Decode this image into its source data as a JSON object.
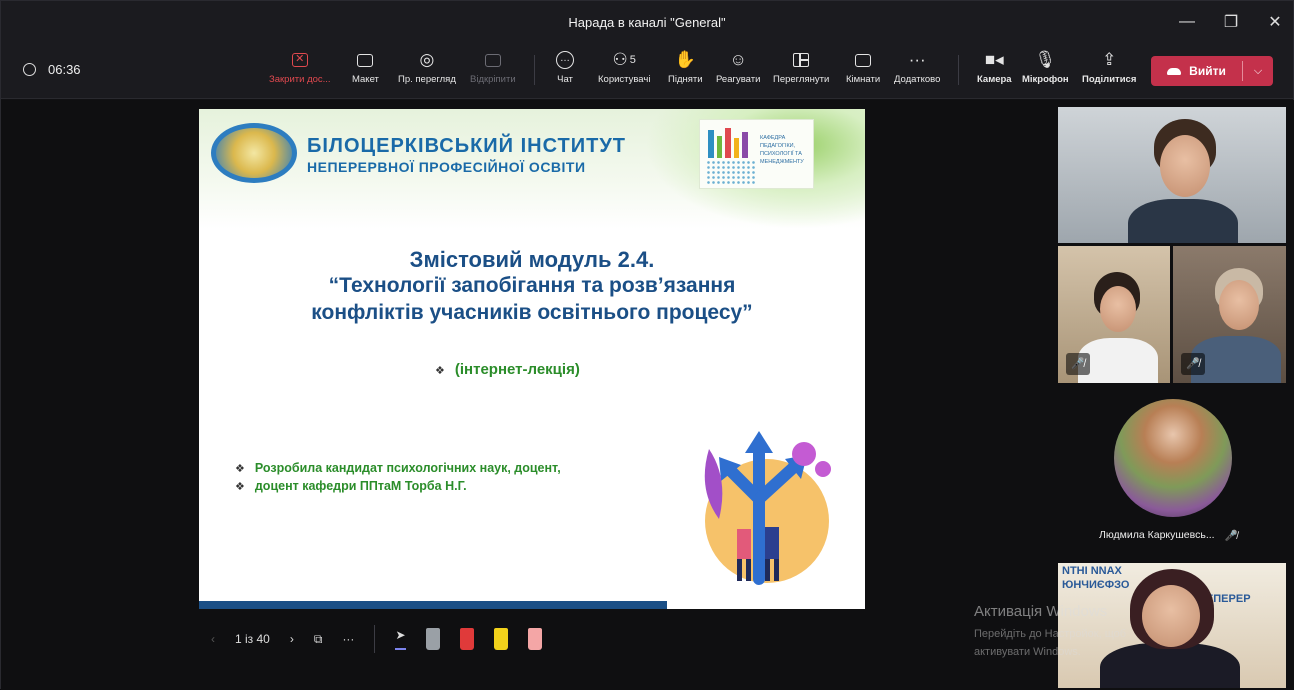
{
  "window": {
    "title": "Нарада в каналі \"General\""
  },
  "window_controls": {
    "minimize": "—",
    "maximize": "❐",
    "close": "✕"
  },
  "toolbar": {
    "timer": "06:36",
    "stop_sharing": "Закрити дос...",
    "layout": "Макет",
    "presenter_view": "Пр. перегляд",
    "pop_out": "Відкріпити",
    "chat": "Чат",
    "people": "Користувачі",
    "people_count": "5",
    "raise_hand": "Підняти",
    "react": "Реагувати",
    "view": "Переглянути",
    "rooms": "Кімнати",
    "more": "Додатково",
    "camera": "Камера",
    "mic": "Мікрофон",
    "share": "Поділитися",
    "leave": "Вийти"
  },
  "slide": {
    "institute_line1": "БІЛОЦЕРКІВСЬКИЙ ІНСТИТУТ",
    "institute_line2": "НЕПЕРЕРВНОЇ ПРОФЕСІЙНОЇ ОСВІТИ",
    "dept_logo_text": "КАФЕДРА ПЕДАГОГІКИ, ПСИХОЛОГІЇ ТА МЕНЕДЖМЕНТУ",
    "module_title": "Змістовий модуль 2.4.",
    "module_subtitle1": "“Технології запобігання та розв’язання",
    "module_subtitle2": "конфліктів учасників освітнього процесу”",
    "lecture_type": "(інтернет-лекція)",
    "author_line1": "Розробила кандидат психологічних наук, доцент,",
    "author_line2": "доцент кафедри ППтаМ Торба Н.Г.",
    "bullet": "❖"
  },
  "slide_controls": {
    "page_indicator": "1 із 40",
    "prev": "‹",
    "next": "›",
    "more": "···",
    "pen_colors": [
      "#9aa0a6",
      "#e03a3a",
      "#f2d21b",
      "#f4a6a6"
    ]
  },
  "participants": {
    "avatar_name": "Людмила Каркушевсь...",
    "mute_icon": "🎤̸"
  },
  "self_view_text": [
    "NTHI NNAX",
    "ЮНЧИЄФЗО",
    "НЕПЕРЕР"
  ],
  "watermark": {
    "title": "Активація Windows",
    "line1": "Перейдіть до Настройок, щоб",
    "line2": "активувати Windows."
  }
}
